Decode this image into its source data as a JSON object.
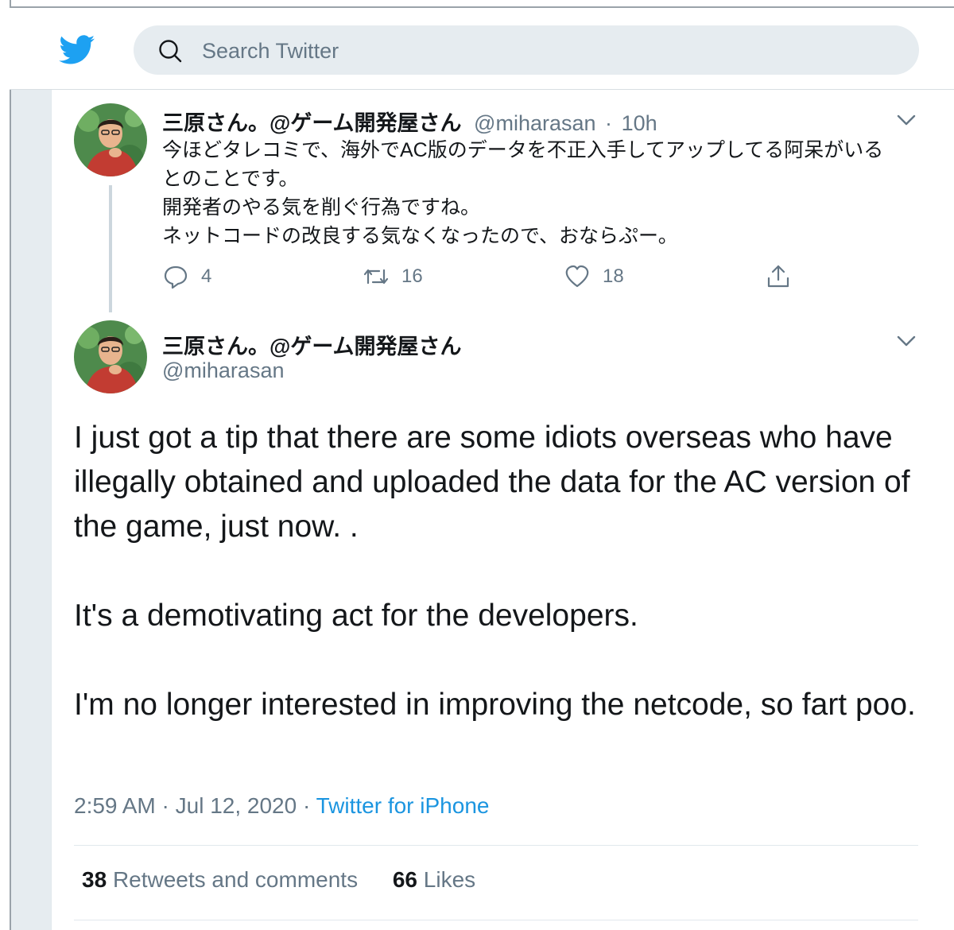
{
  "search": {
    "placeholder": "Search Twitter"
  },
  "colors": {
    "brand": "#1da1f2",
    "link": "#1b95e0",
    "muted": "#657786",
    "text": "#14171a"
  },
  "icons": {
    "logo": "twitter-bird-icon",
    "search": "search-icon",
    "more": "chevron-down-icon",
    "reply": "reply-icon",
    "retweet": "retweet-icon",
    "like": "heart-icon",
    "share": "share-icon"
  },
  "parent_tweet": {
    "display_name": "三原さん。@ゲーム開発屋さん",
    "handle": "@miharasan",
    "separator": "·",
    "time": "10h",
    "lines": [
      "今ほどタレコミで、海外でAC版のデータを不正入手してアップしてる阿呆がいる",
      "とのことです。",
      "開発者のやる気を削ぐ行為ですね。",
      "ネットコードの改良する気なくなったので、おならぷー。"
    ],
    "replies": "4",
    "retweets": "16",
    "likes": "18"
  },
  "main_tweet": {
    "display_name": "三原さん。@ゲーム開発屋さん",
    "handle": "@miharasan",
    "paragraphs": [
      "I just got a tip that there are some idiots overseas who have illegally obtained and uploaded the data for the AC version of the game, just now. .",
      "It's a demotivating act for the developers.",
      "I'm no longer interested in improving the netcode, so fart poo."
    ],
    "time": "2:59 AM",
    "date": "Jul 12, 2020",
    "dot": "·",
    "source": "Twitter for iPhone",
    "retweets_count": "38",
    "retweets_label": "Retweets and comments",
    "likes_count": "66",
    "likes_label": "Likes"
  }
}
